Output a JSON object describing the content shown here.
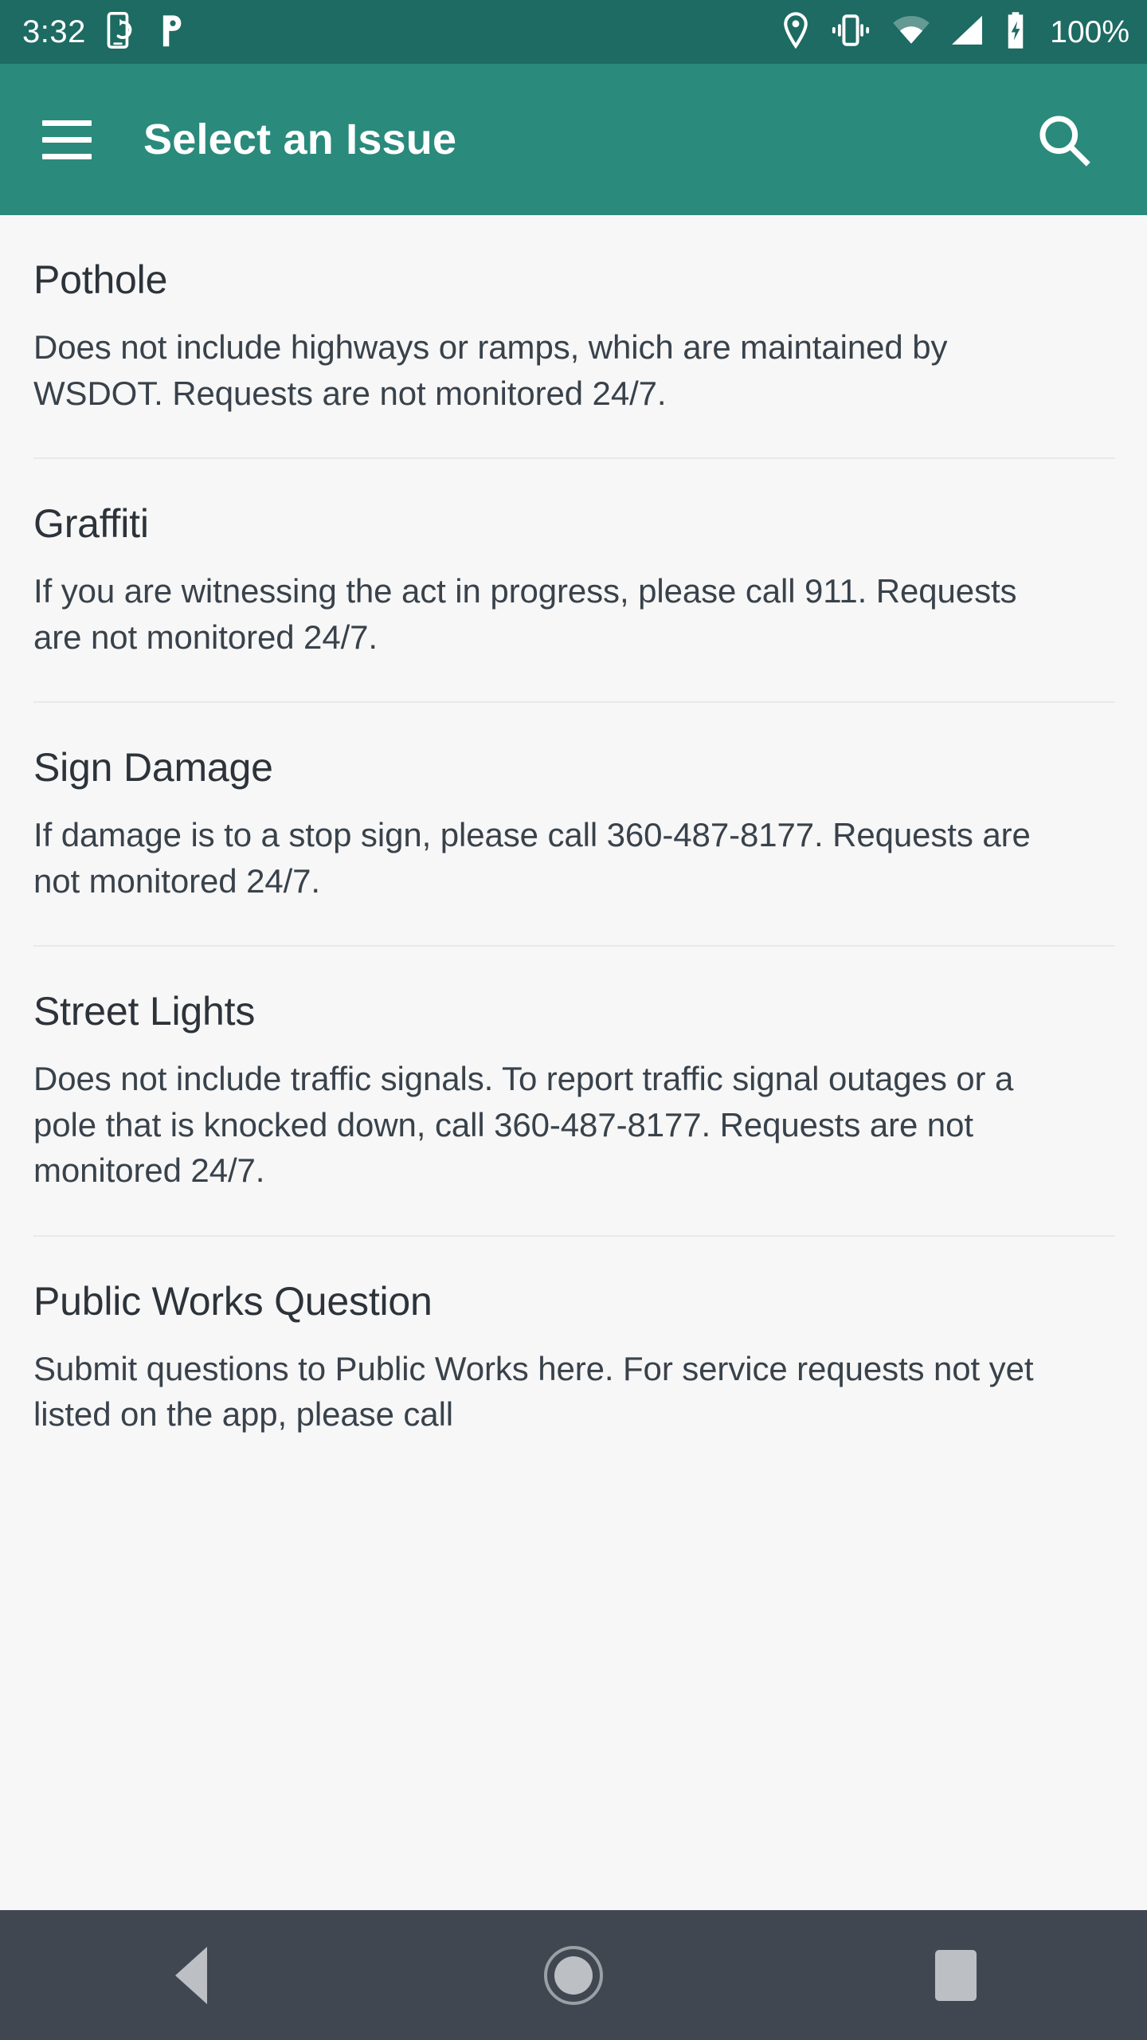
{
  "status_bar": {
    "clock": "3:32",
    "battery_label": "100%",
    "left_icons": [
      "phone-sync-icon",
      "p-app-icon"
    ],
    "right_icons": [
      "location-icon",
      "vibrate-icon",
      "wifi-icon",
      "cellular-signal-icon",
      "battery-charging-icon"
    ],
    "background_color": "#1d6b62",
    "foreground_color": "#ffffff"
  },
  "app_bar": {
    "title": "Select an Issue",
    "menu_icon": "hamburger-menu-icon",
    "search_icon": "search-icon",
    "background_color": "#2a8a7c",
    "foreground_color": "#ffffff"
  },
  "issues": [
    {
      "title": "Pothole",
      "description": "Does not include highways or ramps, which are maintained by WSDOT. Requests are not monitored 24/7."
    },
    {
      "title": "Graffiti",
      "description": "If you are witnessing the act in progress, please call 911. Requests are not monitored 24/7."
    },
    {
      "title": "Sign Damage",
      "description": "If damage is to a stop sign, please call 360-487-8177. Requests are not monitored 24/7."
    },
    {
      "title": "Street Lights",
      "description": "Does not include traffic signals. To report traffic signal outages or a pole that is knocked down, call 360-487-8177. Requests are not monitored 24/7."
    },
    {
      "title": "Public Works Question",
      "description": "Submit questions to Public Works here. For service requests not yet listed on the app, please call"
    }
  ],
  "nav_bar": {
    "back_label": "Back",
    "home_label": "Home",
    "recents_label": "Recents",
    "back_icon": "triangle-back-icon",
    "home_icon": "circle-home-icon",
    "recents_icon": "square-recents-icon",
    "background_color": "#414750"
  },
  "theme": {
    "page_background": "#f7f7f7",
    "divider_color": "#e9e9e9",
    "title_color": "#2d333a",
    "body_color": "#39424b"
  }
}
